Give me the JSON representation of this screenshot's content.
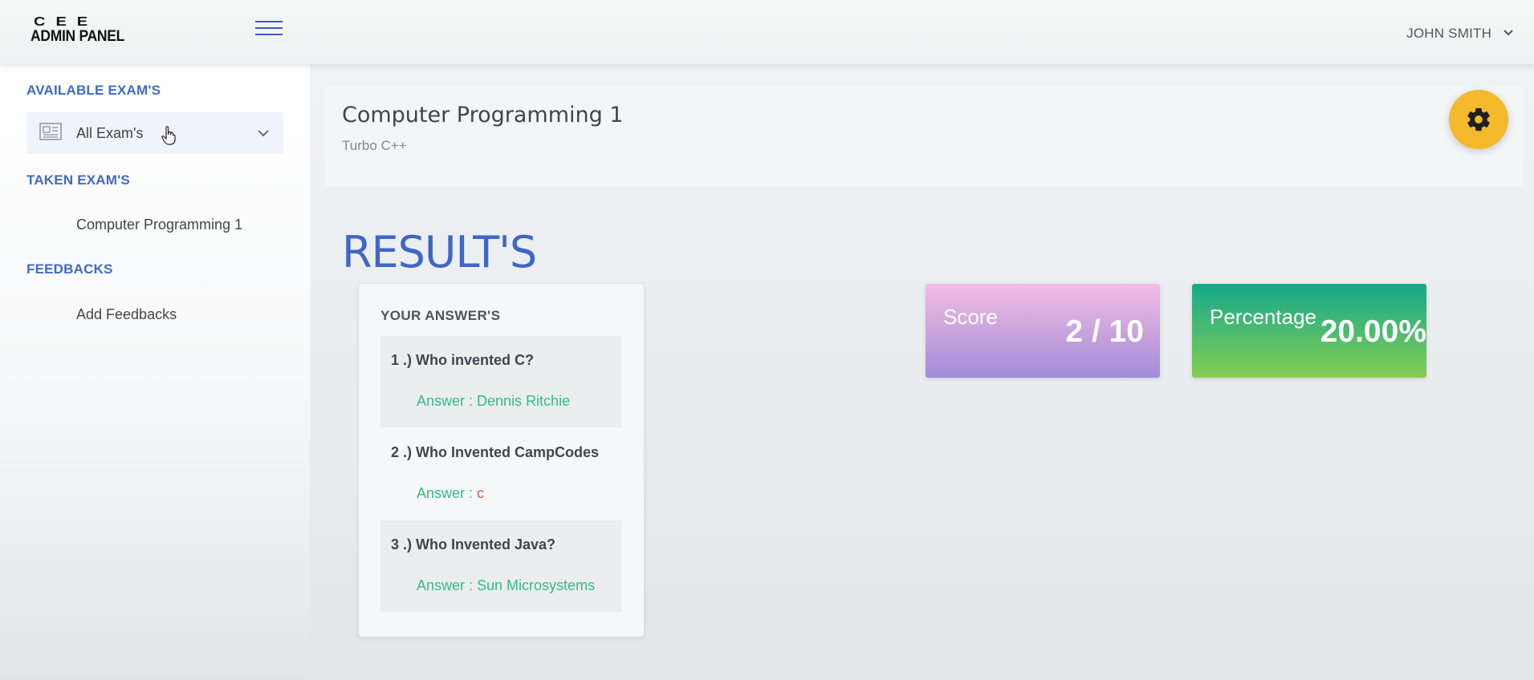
{
  "header": {
    "logo_line1": "CEE",
    "logo_line2": "ADMIN PANEL",
    "user_name": "JOHN SMITH"
  },
  "sidebar": {
    "available_heading": "AVAILABLE EXAM'S",
    "all_exams_label": "All Exam's",
    "taken_heading": "TAKEN EXAM'S",
    "taken_items": [
      "Computer Programming 1"
    ],
    "feedbacks_heading": "FEEDBACKS",
    "feedback_items": [
      "Add Feedbacks"
    ]
  },
  "page": {
    "title": "Computer Programming 1",
    "subtitle": "Turbo C++",
    "results_title": "RESULT'S"
  },
  "answers": {
    "heading": "YOUR ANSWER'S",
    "items": [
      {
        "question": "1 .) Who invented C?",
        "answer_prefix": "Answer : ",
        "answer": "Dennis Ritchie"
      },
      {
        "question": "2 .) Who Invented CampCodes",
        "answer_prefix": "Answer : ",
        "answer": "c"
      },
      {
        "question": "3 .) Who Invented Java?",
        "answer_prefix": "Answer : ",
        "answer": "Sun Microsystems"
      }
    ]
  },
  "stats": {
    "score_label": "Score",
    "score_value": "2 / 10",
    "percentage_label": "Percentage",
    "percentage_value": "20.00%"
  },
  "colors": {
    "accent": "#3f66c7",
    "gear_button": "#f4b82b",
    "answer_correct": "#2fbf83",
    "answer_wrong": "#d9534f"
  },
  "icons": {
    "menu": "hamburger-icon",
    "user_dropdown": "chevron-down-icon",
    "exam_list": "newspaper-icon",
    "settings": "gear-icon"
  }
}
